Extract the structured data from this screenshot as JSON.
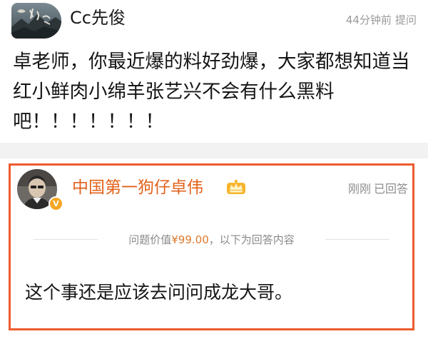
{
  "question": {
    "author_name": "Cc先俊",
    "time_ago": "44分钟前",
    "action_label": "提问",
    "body": "卓老师，你最近爆的料好劲爆，大家都想知道当红小鲜肉小绵羊张艺兴不会有什么黑料吧！！！！！！！",
    "avatar_icon": "landscape-avatar-icon"
  },
  "answer": {
    "author_name": "中国第一狗仔卓伟",
    "time_ago": "刚刚",
    "status_label": "已回答",
    "badge_icon": "crown-icon",
    "verified_icon": "verified-v-icon",
    "price_prefix": "问题价值",
    "price_value": "¥99.00",
    "price_suffix": "，以下为回答内容",
    "body": "这个事还是应该去问问成龙大哥。"
  },
  "colors": {
    "highlight_border": "#ee5a2e",
    "answer_author": "#e2621b",
    "price": "#e0792b",
    "meta_text": "#9a9a9a"
  }
}
